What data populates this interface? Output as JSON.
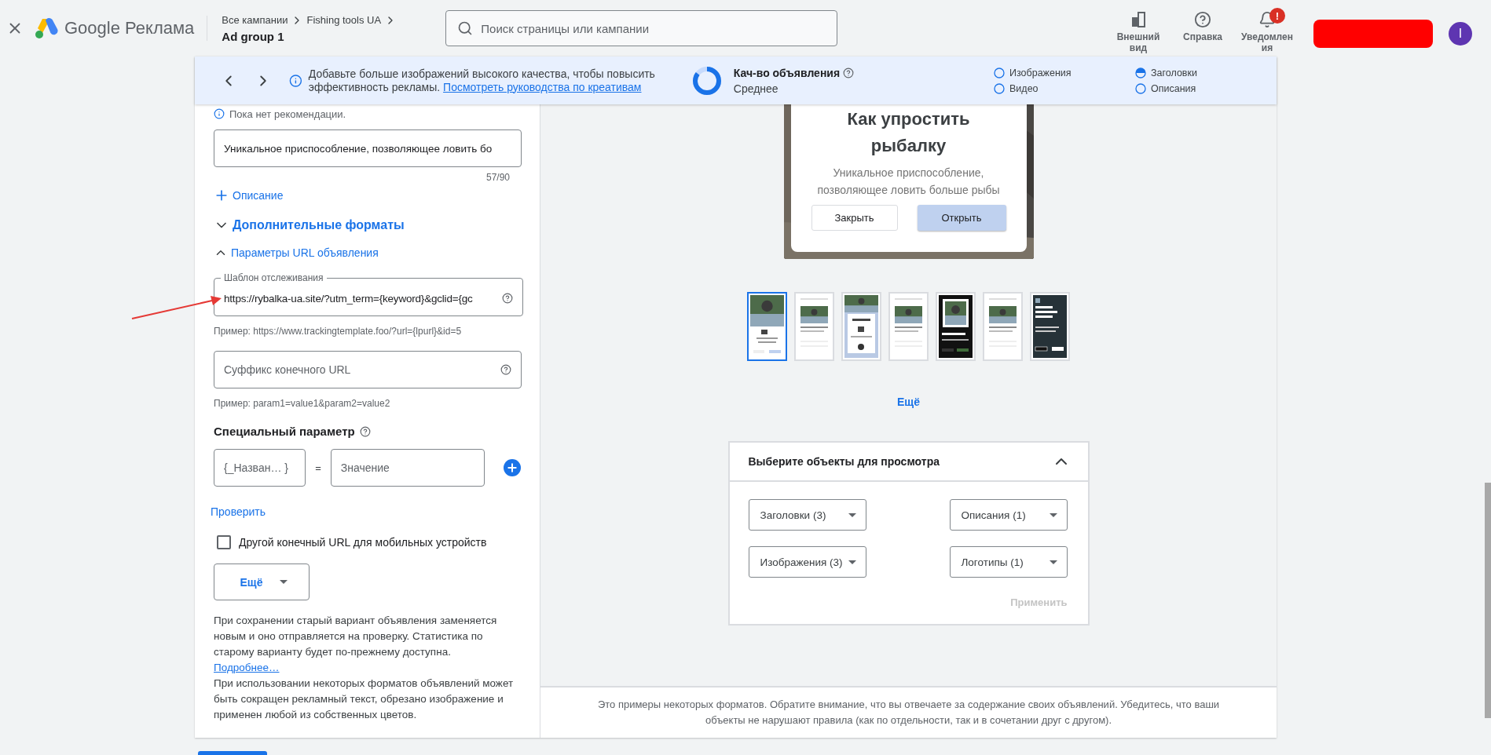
{
  "logo": {
    "brand": "Google",
    "product": "Реклама"
  },
  "breadcrumbs": {
    "path": [
      "Все кампании",
      "Fishing tools UA"
    ],
    "current": "Ad group 1"
  },
  "search": {
    "placeholder": "Поиск страницы или кампании"
  },
  "header_actions": [
    {
      "kind": "appearance",
      "label": "Внешний вид"
    },
    {
      "kind": "help",
      "label": "Справка"
    },
    {
      "kind": "notifications",
      "label": "Уведомления",
      "badge": "!"
    }
  ],
  "account": {
    "avatar": "I"
  },
  "banner": {
    "message": "Добавьте больше изображений высокого качества, чтобы повысить эффективность рекламы.",
    "link": "Посмотреть руководства по креативам",
    "quality": {
      "title": "Кач-во объявления",
      "rating": "Среднее"
    },
    "legend": [
      {
        "label": "Изображения",
        "half_filled": false
      },
      {
        "label": "Видео",
        "half_filled": false
      },
      {
        "label": "Заголовки",
        "half_filled": true
      },
      {
        "label": "Описания",
        "half_filled": false
      }
    ]
  },
  "editor": {
    "recommendation": "Пока нет рекомендации.",
    "description": {
      "value": "Уникальное приспособление, позволяющее ловить бо",
      "counter": "57/90"
    },
    "add_description": "Описание",
    "more_formats": {
      "label": "Дополнительные форматы",
      "expanded": false
    },
    "url_options": {
      "label": "Параметры URL объявления",
      "expanded": true
    },
    "tracking_template": {
      "label": "Шаблон отслеживания",
      "value": "https://rybalka-ua.site/?utm_term={keyword}&gclid={gc",
      "hint": "Пример: https://www.trackingtemplate.foo/?url={lpurl}&id=5"
    },
    "final_url_suffix": {
      "placeholder": "Суффикс конечного URL",
      "hint": "Пример: param1=value1&param2=value2"
    },
    "custom_parameter": {
      "title": "Специальный параметр",
      "name_placeholder": "{_Назван… }",
      "equals": "=",
      "value_placeholder": "Значение"
    },
    "test_link": "Проверить",
    "mobile_url": {
      "label": "Другой конечный URL для мобильных устройств",
      "checked": false
    },
    "more_dropdown": "Ещё",
    "note": "При сохранении старый вариант объявления заменяется новым и оно отправляется на проверку. Статистика по старому варианту будет по-прежнему доступна.",
    "note_link": "Подробнее…",
    "note2": "При использовании некоторых форматов объявлений может быть сокращен рекламный текст, обрезано изображение и применен любой из собственных цветов."
  },
  "preview": {
    "ad": {
      "headline": "Как упростить рыбалку",
      "description": "Уникальное приспособление, позволяющее ловить больше рыбы",
      "buttons": [
        "Закрыть",
        "Открыть"
      ]
    },
    "thumbnails": [
      {
        "kind": "photo-card",
        "selected": true
      },
      {
        "kind": "light-list",
        "selected": false
      },
      {
        "kind": "blue-card",
        "selected": false
      },
      {
        "kind": "light-list",
        "selected": false
      },
      {
        "kind": "dark-photo",
        "selected": false
      },
      {
        "kind": "light-list",
        "selected": false
      },
      {
        "kind": "dark-text",
        "selected": false
      }
    ],
    "more": "Ещё"
  },
  "selector": {
    "title": "Выберите объекты для просмотра",
    "expanded": true,
    "dropdowns": [
      "Заголовки (3)",
      "Описания (1)",
      "Изображения (3)",
      "Логотипы (1)"
    ],
    "apply": {
      "label": "Применить",
      "disabled": true
    }
  },
  "footer_note": "Это примеры некоторых форматов. Обратите внимание, что вы отвечаете за содержание своих объявлений. Убедитесь, что ваши объекты не нарушают правила (как по отдельности, так и в сочетании друг с другом)."
}
